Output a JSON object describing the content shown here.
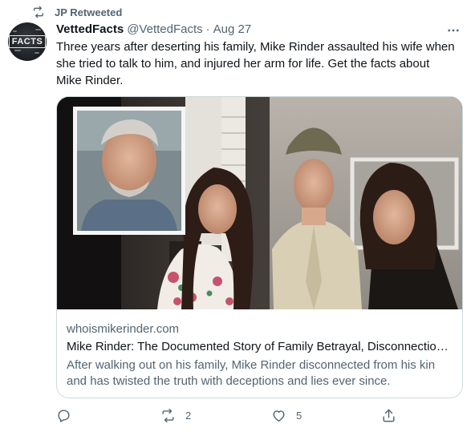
{
  "retweet": {
    "label": "JP Retweeted"
  },
  "author": {
    "avatar_text": "FACTS",
    "name": "VettedFacts",
    "handle": "@VettedFacts",
    "separator": "·",
    "date": "Aug 27"
  },
  "tweet": {
    "text": "Three years after deserting his family, Mike Rinder assaulted his wife when she tried to talk to him, and injured her arm for life. Get the facts about Mike Rinder."
  },
  "card": {
    "domain": "whoismikerinder.com",
    "title": "Mike Rinder: The Documented Story of Family Betrayal, Disconnectio…",
    "description": "After walking out on his family, Mike Rinder disconnected from his kin and has twisted the truth with deceptions and lies ever since."
  },
  "actions": {
    "reply": {
      "icon": "reply-icon",
      "count": ""
    },
    "retweet": {
      "icon": "retweet-icon",
      "count": "2"
    },
    "like": {
      "icon": "heart-icon",
      "count": "5"
    },
    "share": {
      "icon": "share-icon",
      "count": ""
    }
  },
  "colors": {
    "text": "#0f1419",
    "secondary": "#536471",
    "border": "#cfd9de"
  }
}
